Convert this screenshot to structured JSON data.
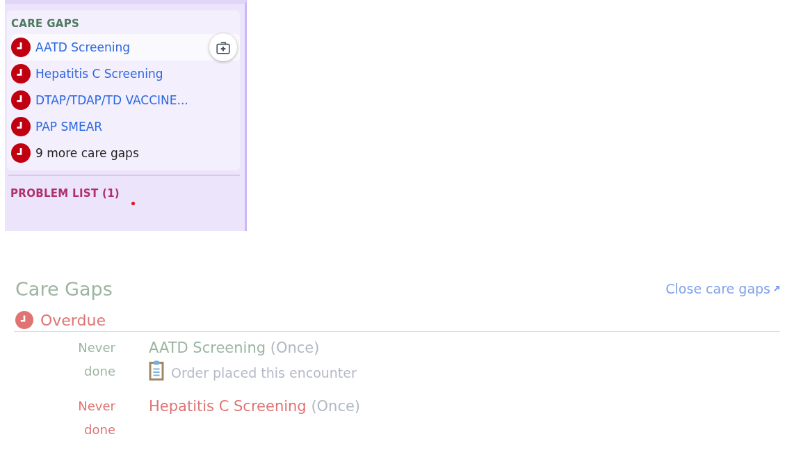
{
  "sidebar": {
    "section_title": "CARE GAPS",
    "items": [
      {
        "label": "AATD Screening",
        "kind": "gap",
        "highlighted": true
      },
      {
        "label": "Hepatitis C Screening",
        "kind": "gap",
        "highlighted": false
      },
      {
        "label": "DTAP/TDAP/TD VACCINE...",
        "kind": "gap",
        "highlighted": false
      },
      {
        "label": "PAP SMEAR",
        "kind": "gap",
        "highlighted": false
      },
      {
        "label": "9 more care gaps",
        "kind": "more",
        "highlighted": false
      }
    ],
    "next_section": {
      "label": "PROBLEM LIST (1)",
      "indicator": true
    }
  },
  "report": {
    "title": "Care Gaps",
    "close_link": "Close care gaps",
    "group": "Overdue",
    "rows": [
      {
        "when": "Never done",
        "name": "AATD Screening",
        "frequency": "(Once)",
        "kind": "addressed",
        "note": "Order placed this encounter"
      },
      {
        "when": "Never done",
        "name": "Hepatitis C Screening",
        "frequency": "(Once)",
        "kind": "overdue"
      }
    ]
  }
}
